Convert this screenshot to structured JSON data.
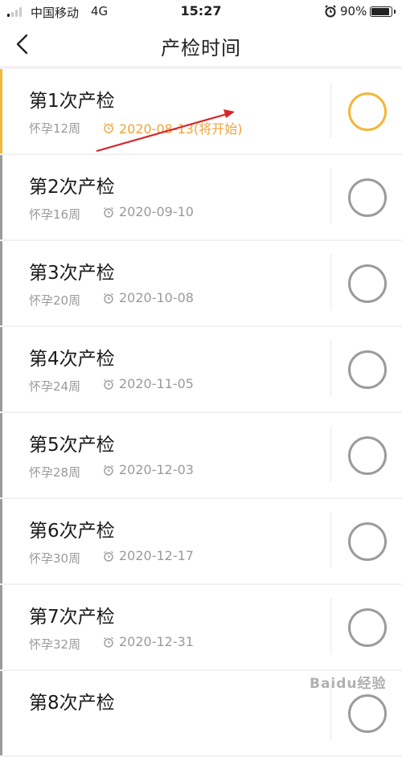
{
  "status_bar": {
    "carrier": "中国移动",
    "network": "4G",
    "time": "15:27",
    "battery": "90%"
  },
  "nav": {
    "title": "产检时间"
  },
  "items": [
    {
      "title": "第1次产检",
      "weeks": "怀孕12周",
      "date": "2020-08-13(将开始)",
      "active": true
    },
    {
      "title": "第2次产检",
      "weeks": "怀孕16周",
      "date": "2020-09-10",
      "active": false
    },
    {
      "title": "第3次产检",
      "weeks": "怀孕20周",
      "date": "2020-10-08",
      "active": false
    },
    {
      "title": "第4次产检",
      "weeks": "怀孕24周",
      "date": "2020-11-05",
      "active": false
    },
    {
      "title": "第5次产检",
      "weeks": "怀孕28周",
      "date": "2020-12-03",
      "active": false
    },
    {
      "title": "第6次产检",
      "weeks": "怀孕30周",
      "date": "2020-12-17",
      "active": false
    },
    {
      "title": "第7次产检",
      "weeks": "怀孕32周",
      "date": "2020-12-31",
      "active": false
    },
    {
      "title": "第8次产检",
      "weeks": "",
      "date": "",
      "active": false
    }
  ],
  "watermark": "Baidu经验",
  "colors": {
    "accent": "#f2b73b",
    "accent_text": "#f0a43a",
    "inactive": "#9b9b9b",
    "annotation_arrow": "#d6262a"
  }
}
